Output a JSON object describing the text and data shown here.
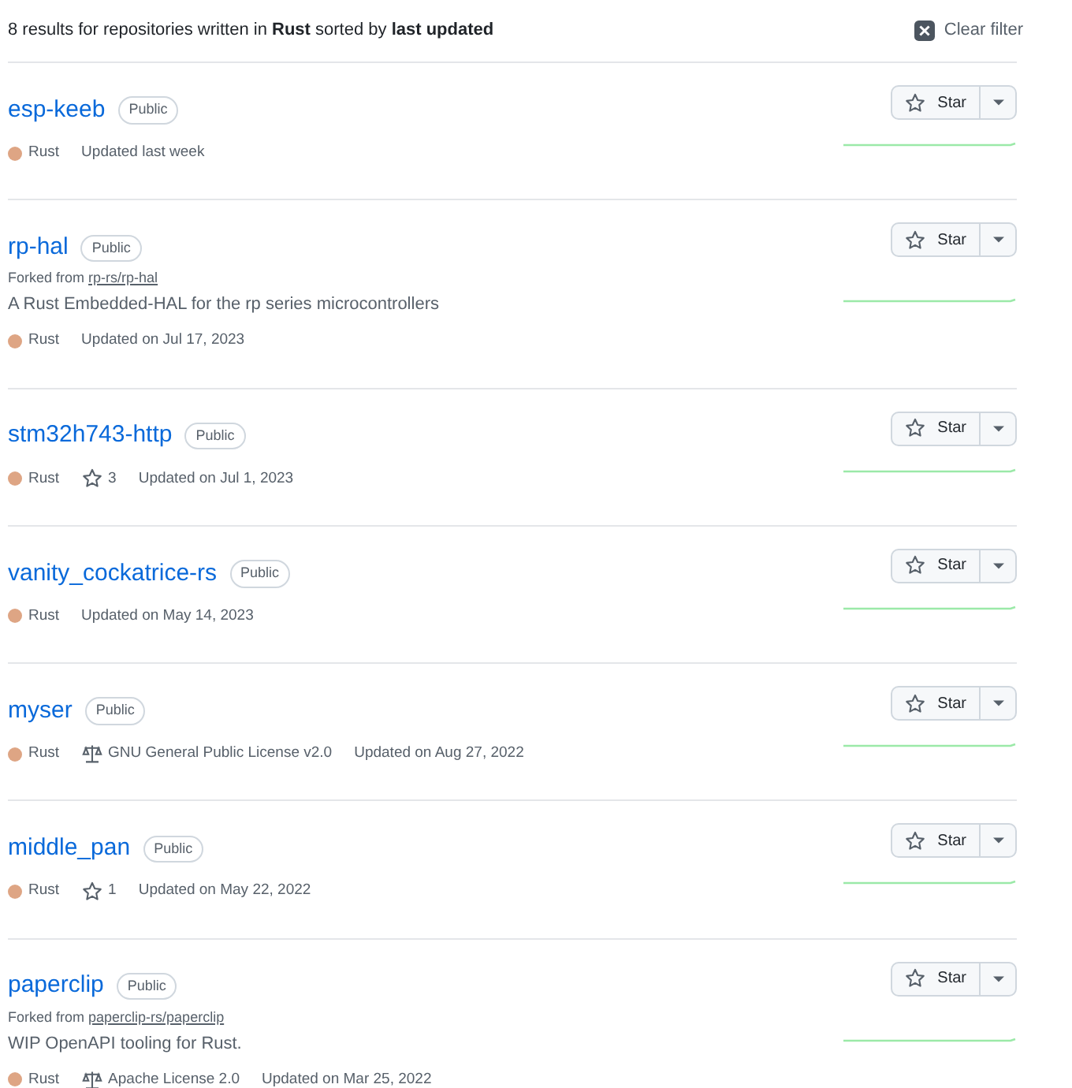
{
  "summary": "8 results for repositories written in **Rust** sorted by **last updated**",
  "clear_filter": "Clear filter",
  "repos": [
    {
      "name": "esp-keeb",
      "visibility": "Public",
      "star_label": "Star",
      "meta": [
        {
          "kind": "language",
          "text": "Rust",
          "color": "#dea584"
        },
        {
          "kind": "updated",
          "text": "Updated last week"
        }
      ]
    },
    {
      "name": "rp-hal",
      "visibility": "Public",
      "fork_prefix": "Forked from",
      "fork_source": "rp-rs/rp-hal",
      "description": "A Rust Embedded-HAL for the rp series microcontrollers",
      "star_label": "Star",
      "meta": [
        {
          "kind": "language",
          "text": "Rust",
          "color": "#dea584"
        },
        {
          "kind": "updated",
          "text": "Updated on Jul 17, 2023"
        }
      ]
    },
    {
      "name": "stm32h743-http",
      "visibility": "Public",
      "star_label": "Star",
      "meta": [
        {
          "kind": "language",
          "text": "Rust",
          "color": "#dea584"
        },
        {
          "kind": "stars",
          "text": "3"
        },
        {
          "kind": "updated",
          "text": "Updated on Jul 1, 2023"
        }
      ]
    },
    {
      "name": "vanity_cockatrice-rs",
      "visibility": "Public",
      "star_label": "Star",
      "meta": [
        {
          "kind": "language",
          "text": "Rust",
          "color": "#dea584"
        },
        {
          "kind": "updated",
          "text": "Updated on May 14, 2023"
        }
      ]
    },
    {
      "name": "myser",
      "visibility": "Public",
      "star_label": "Star",
      "meta": [
        {
          "kind": "language",
          "text": "Rust",
          "color": "#dea584"
        },
        {
          "kind": "license",
          "text": "GNU General Public License v2.0"
        },
        {
          "kind": "updated",
          "text": "Updated on Aug 27, 2022"
        }
      ]
    },
    {
      "name": "middle_pan",
      "visibility": "Public",
      "star_label": "Star",
      "meta": [
        {
          "kind": "language",
          "text": "Rust",
          "color": "#dea584"
        },
        {
          "kind": "stars",
          "text": "1"
        },
        {
          "kind": "updated",
          "text": "Updated on May 22, 2022"
        }
      ]
    },
    {
      "name": "paperclip",
      "visibility": "Public",
      "fork_prefix": "Forked from",
      "fork_source": "paperclip-rs/paperclip",
      "description": "WIP OpenAPI tooling for Rust.",
      "star_label": "Star",
      "meta": [
        {
          "kind": "language",
          "text": "Rust",
          "color": "#dea584"
        },
        {
          "kind": "license",
          "text": "Apache License 2.0"
        },
        {
          "kind": "updated",
          "text": "Updated on Mar 25, 2022"
        }
      ]
    }
  ]
}
